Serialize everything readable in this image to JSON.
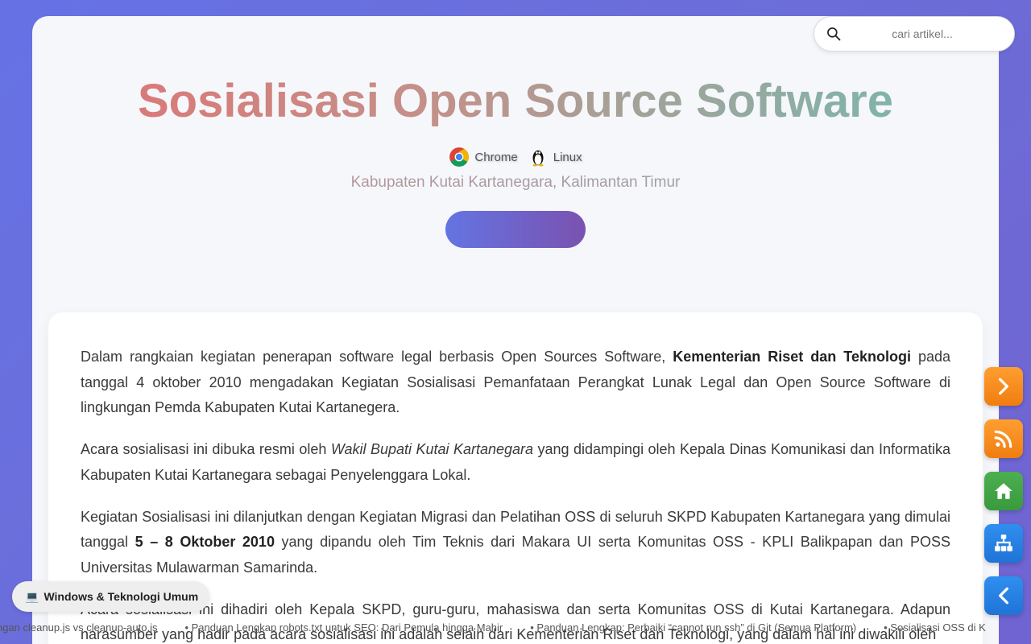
{
  "search": {
    "placeholder": "cari artikel..."
  },
  "header": {
    "title": "Sosialisasi Open Source Software",
    "tags": [
      {
        "label": "Chrome",
        "icon": "chrome-icon"
      },
      {
        "label": "Linux",
        "icon": "linux-tux-icon"
      }
    ],
    "subtitle": "Kabupaten Kutai Kartanegara, Kalimantan Timur",
    "pill_button_label": ""
  },
  "article": {
    "p1": {
      "a": "Dalam rangkaian kegiatan penerapan software legal berbasis Open Sources Software, ",
      "b": "Kementerian Riset dan Teknologi",
      "c": " pada tanggal 4 oktober 2010 mengadakan Kegiatan Sosialisasi Pemanfataan Perangkat Lunak Legal dan Open Source Software di lingkungan Pemda Kabupaten Kutai Kartanegera."
    },
    "p2": {
      "a": "Acara sosialisasi ini dibuka resmi oleh ",
      "b": "Wakil Bupati Kutai Kartanegara",
      "c": " yang didampingi oleh Kepala Dinas Komunikasi dan Informatika Kabupaten Kutai Kartanegara sebagai Penyelenggara Lokal."
    },
    "p3": {
      "a": "Kegiatan Sosialisasi ini dilanjutkan dengan Kegiatan Migrasi dan Pelatihan OSS di seluruh SKPD Kabupaten Kartanegara yang dimulai tanggal ",
      "b": "5 – 8 Oktober 2010",
      "c": " yang dipandu oleh Tim Teknis dari Makara UI serta Komunitas OSS - KPLI Balikpapan dan POSS Universitas Mulawarman Samarinda."
    },
    "p4": "Acara sosialisasi ini dihadiri oleh Kepala SKPD, guru-guru, mahasiswa dan serta Komunitas OSS di Kutai Kartanegara. Adapun narasumber yang hadir pada acara sosialisasi ini adalah selain dari Kementerian Riset dan Teknologi, yang dalam hal ini diwakili oleh"
  },
  "floating_buttons": [
    {
      "name": "next-article-button",
      "icon": "chevron-right-icon",
      "color": "#f5891c"
    },
    {
      "name": "rss-button",
      "icon": "rss-icon",
      "color": "#f5891c"
    },
    {
      "name": "home-button",
      "icon": "home-icon",
      "color": "#43a547"
    },
    {
      "name": "sitemap-button",
      "icon": "sitemap-icon",
      "color": "#2783e6"
    },
    {
      "name": "back-button",
      "icon": "chevron-left-icon",
      "color": "#2783e6"
    }
  ],
  "category_chip": {
    "icon": "💻",
    "label": "Windows & Teknologi Umum"
  },
  "ticker": [
    "ngan cleanup.js vs cleanup-auto.js",
    "• Panduan Lengkap robots.txt untuk SEO: Dari Pemula hingga Mahir",
    "• Panduan Lengkap: Perbaiki “cannot run ssh” di Git (Semua Platform)",
    "• Sosialisasi OSS di K"
  ]
}
